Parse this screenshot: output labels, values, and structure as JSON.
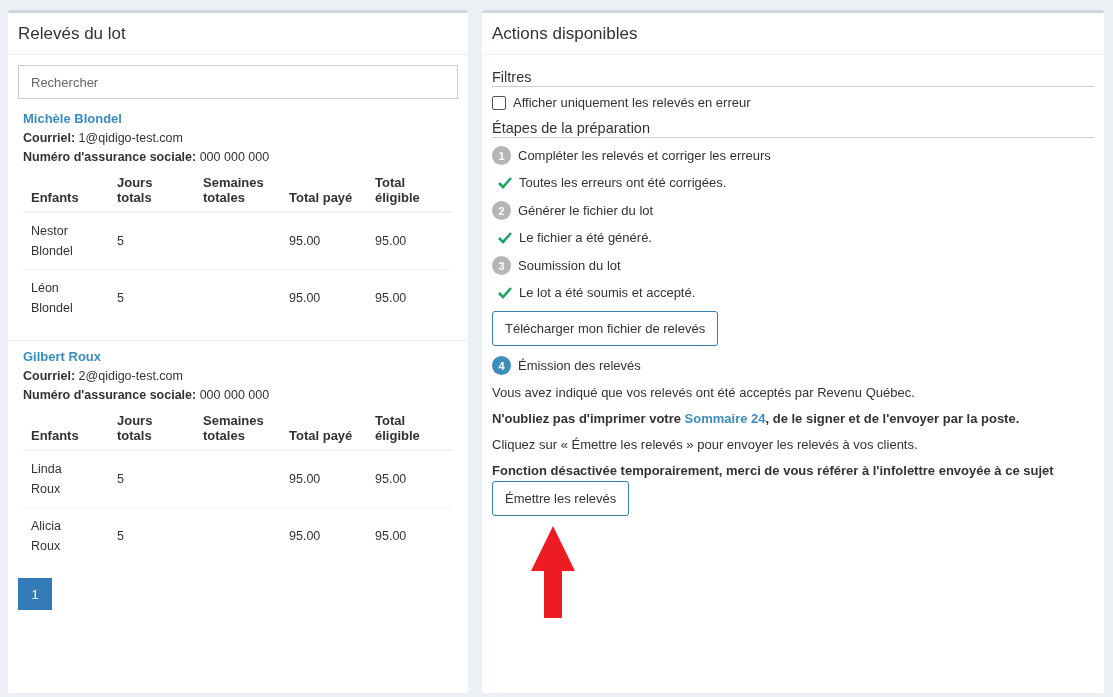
{
  "left_panel": {
    "title": "Relevés du lot",
    "search": {
      "placeholder": "Rechercher"
    },
    "clients": [
      {
        "name": "Michèle Blondel",
        "email_label": "Courriel:",
        "email": "1@qidigo-test.com",
        "sin_label": "Numéro d'assurance sociale:",
        "sin": "000 000 000",
        "columns": [
          "Enfants",
          "Jours totals",
          "Semaines totales",
          "Total payé",
          "Total éligible"
        ],
        "rows": [
          [
            "Nestor Blondel",
            "5",
            "",
            "95.00",
            "95.00"
          ],
          [
            "Léon Blondel",
            "5",
            "",
            "95.00",
            "95.00"
          ]
        ]
      },
      {
        "name": "Gilbert Roux",
        "email_label": "Courriel:",
        "email": "2@qidigo-test.com",
        "sin_label": "Numéro d'assurance sociale:",
        "sin": "000 000 000",
        "columns": [
          "Enfants",
          "Jours totals",
          "Semaines totales",
          "Total payé",
          "Total éligible"
        ],
        "rows": [
          [
            "Linda Roux",
            "5",
            "",
            "95.00",
            "95.00"
          ],
          [
            "Alicia Roux",
            "5",
            "",
            "95.00",
            "95.00"
          ]
        ]
      }
    ],
    "pagination": [
      {
        "label": "1",
        "selected": true
      }
    ]
  },
  "right_panel": {
    "title": "Actions disponibles",
    "filters_heading": "Filtres",
    "filter": {
      "label": "Afficher uniquement les relevés en erreur",
      "checked": false
    },
    "steps_heading": "Étapes de la préparation",
    "steps": [
      {
        "number": "1",
        "label": "Compléter les relevés et corriger les erreurs",
        "active": false,
        "status": "Toutes les erreurs ont été corrigées."
      },
      {
        "number": "2",
        "label": "Générer le fichier du lot",
        "active": false,
        "status": "Le fichier a été généré."
      },
      {
        "number": "3",
        "label": "Soumission du lot",
        "active": false,
        "status": "Le lot a été soumis et accepté.",
        "button": "Télécharger mon fichier de relevés"
      },
      {
        "number": "4",
        "label": "Émission des relevés",
        "active": true
      }
    ],
    "info_text": "Vous avez indiqué que vos relevés ont été acceptés par Revenu Québec.",
    "reminder": {
      "before": "N'oubliez pas d'imprimer votre ",
      "link": "Sommaire 24",
      "after": ", de le signer et de l'envoyer par la poste."
    },
    "instruction_text": "Cliquez sur « Émettre les relevés » pour envoyer les relevés à vos clients.",
    "warning_text": "Fonction désactivée temporairement, merci de vous référer à l'infolettre envoyée à ce sujet",
    "emit_button": "Émettre les relevés"
  }
}
